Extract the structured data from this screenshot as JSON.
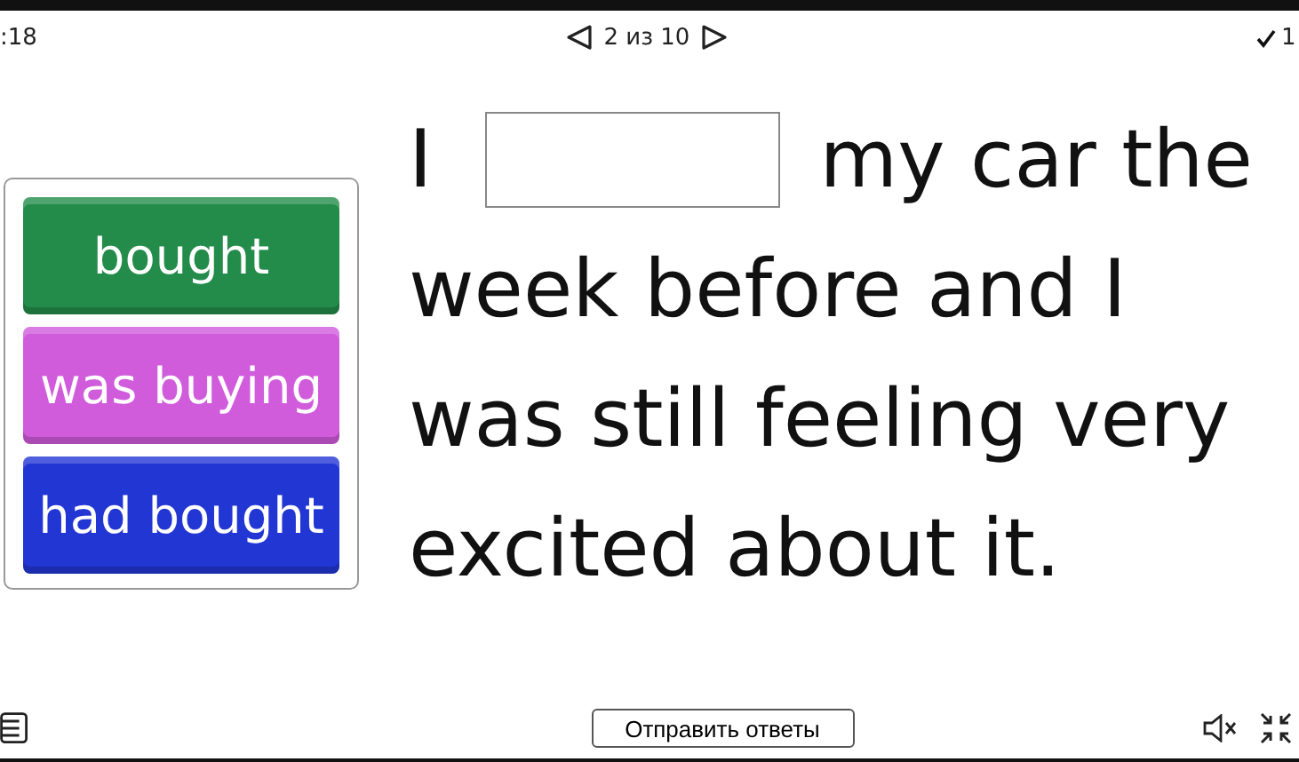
{
  "top_bar": {
    "timer": ":18",
    "pager": "2 из 10",
    "score": "1"
  },
  "options": [
    {
      "label": "bought",
      "color": "#248c4a"
    },
    {
      "label": "was buying",
      "color": "#d05cdc"
    },
    {
      "label": "had bought",
      "color": "#2236d4"
    }
  ],
  "sentence": {
    "before": "I",
    "after": "my car the",
    "continuation": "week before and I was still feeling very excited about it."
  },
  "bottom_bar": {
    "submit": "Отправить ответы"
  }
}
